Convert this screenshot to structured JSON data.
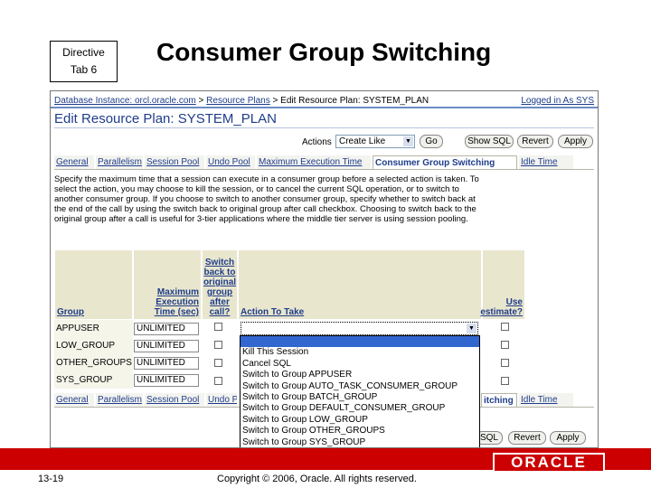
{
  "slide": {
    "directive_line1": "Directive",
    "directive_line2": "Tab 6",
    "title": "Consumer Group Switching",
    "page_number": "13-19",
    "copyright": "Copyright © 2006, Oracle. All rights reserved.",
    "logo": "ORACLE"
  },
  "colors": {
    "accent": "#1f3d8a",
    "brand_red": "#cc0000",
    "header_bg": "#e9e6ce",
    "selection": "#3167ce"
  },
  "breadcrumb": {
    "db_instance": "Database Instance: orcl.oracle.com",
    "sep1": ">",
    "resource_plans": "Resource Plans",
    "sep2": ">",
    "current": "Edit Resource Plan: SYSTEM_PLAN",
    "logged_in": "Logged in As SYS"
  },
  "page_title": "Edit Resource Plan: SYSTEM_PLAN",
  "toolbar": {
    "actions_label": "Actions",
    "actions_value": "Create Like",
    "go": "Go",
    "show_sql": "Show SQL",
    "revert": "Revert",
    "apply": "Apply"
  },
  "tabs": [
    "General",
    "Parallelism",
    "Session Pool",
    "Undo Pool",
    "Maximum Execution Time",
    "Consumer Group Switching",
    "Idle Time"
  ],
  "description": "Specify the maximum time that a session can execute in a consumer group before a selected action is taken. To select the action, you may choose to kill the session, or to cancel the current SQL operation, or to switch to another consumer group. If you choose to switch to another consumer group, specify whether to switch back at the end of the call by using the switch back to original group after call checkbox. Choosing to switch back to the original group after a call is useful for 3-tier applications where the middle tier server is using session pooling.",
  "table": {
    "headers": {
      "group": "Group",
      "max_exec": "Maximum Execution Time (sec)",
      "switch_back": "Switch back to original group after call?",
      "action": "Action To Take",
      "use_estimate": "Use estimate?"
    },
    "rows": [
      {
        "group": "APPUSER",
        "max_exec": "UNLIMITED"
      },
      {
        "group": "LOW_GROUP",
        "max_exec": "UNLIMITED"
      },
      {
        "group": "OTHER_GROUPS",
        "max_exec": "UNLIMITED"
      },
      {
        "group": "SYS_GROUP",
        "max_exec": "UNLIMITED"
      }
    ]
  },
  "dropdown_options": [
    "",
    "Kill This Session",
    "Cancel SQL",
    "Switch to Group APPUSER",
    "Switch to Group AUTO_TASK_CONSUMER_GROUP",
    "Switch to Group BATCH_GROUP",
    "Switch to Group DEFAULT_CONSUMER_GROUP",
    "Switch to Group LOW_GROUP",
    "Switch to Group OTHER_GROUPS",
    "Switch to Group SYS_GROUP"
  ],
  "bottom_tabs_visible_suffix": "itching",
  "bottom_buttons": {
    "show_sql_partial": "SQL",
    "revert": "Revert",
    "apply": "Apply"
  }
}
